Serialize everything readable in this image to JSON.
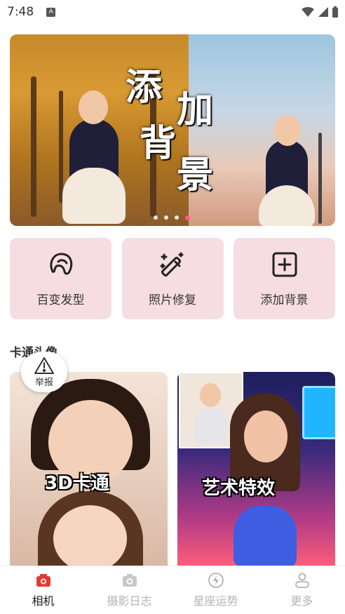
{
  "status_bar": {
    "time": "7:48",
    "notification_icon": "A"
  },
  "banner": {
    "title_chars": [
      "添",
      "加",
      "背",
      "景"
    ],
    "page_count": 4,
    "active_page": 4
  },
  "quick_actions": [
    {
      "label": "百变发型",
      "icon": "hair-style-icon"
    },
    {
      "label": "照片修复",
      "icon": "magic-wand-icon"
    },
    {
      "label": "添加背景",
      "icon": "add-square-icon"
    }
  ],
  "section": {
    "title": "卡通头像",
    "report_label": "举报"
  },
  "feature_cards": [
    {
      "label": "3D卡通"
    },
    {
      "label": "艺术特效"
    }
  ],
  "bottom_nav": [
    {
      "label": "相机",
      "icon": "camera-icon",
      "active": true
    },
    {
      "label": "摄影日志",
      "icon": "camera-log-icon",
      "active": false
    },
    {
      "label": "星座运势",
      "icon": "lightning-icon",
      "active": false
    },
    {
      "label": "更多",
      "icon": "user-icon",
      "active": false
    }
  ],
  "colors": {
    "accent": "#ff5a8a",
    "card_bg": "#f5dde3",
    "nav_inactive": "#b3b3b3",
    "camera_icon": "#e53935"
  }
}
